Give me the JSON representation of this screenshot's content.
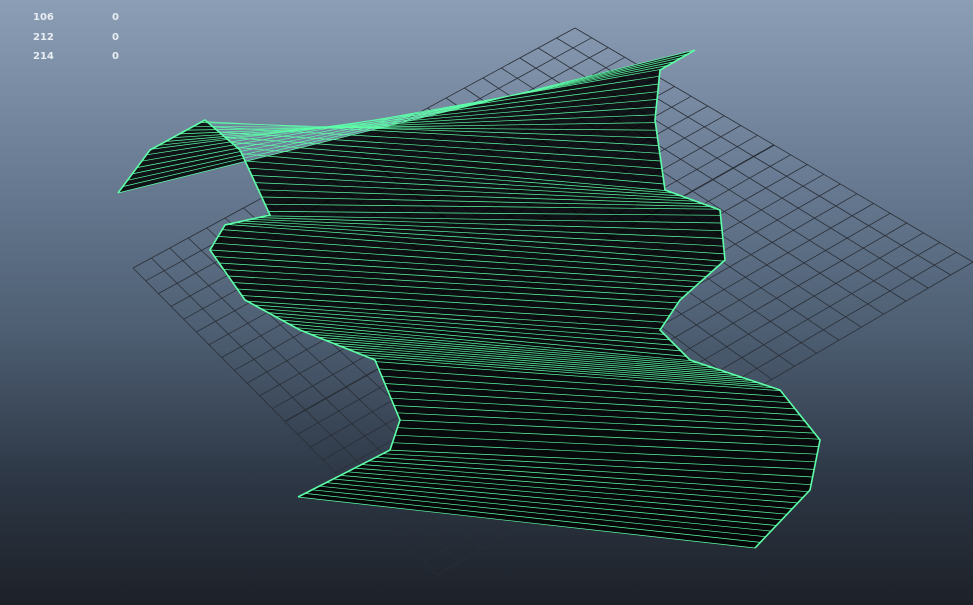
{
  "viewport": {
    "stats": [
      {
        "label": "106",
        "value": "0"
      },
      {
        "label": "212",
        "value": "0"
      },
      {
        "label": "214",
        "value": "0"
      }
    ],
    "colors": {
      "background_top": "#8c9eb5",
      "background_bottom": "#1d2128",
      "grid": "#2a2f37",
      "wireframe": "#5dffa8",
      "surface_shadow": "#000000"
    },
    "icons": [
      "grid-plane",
      "lofted-surface-wireframe"
    ]
  }
}
